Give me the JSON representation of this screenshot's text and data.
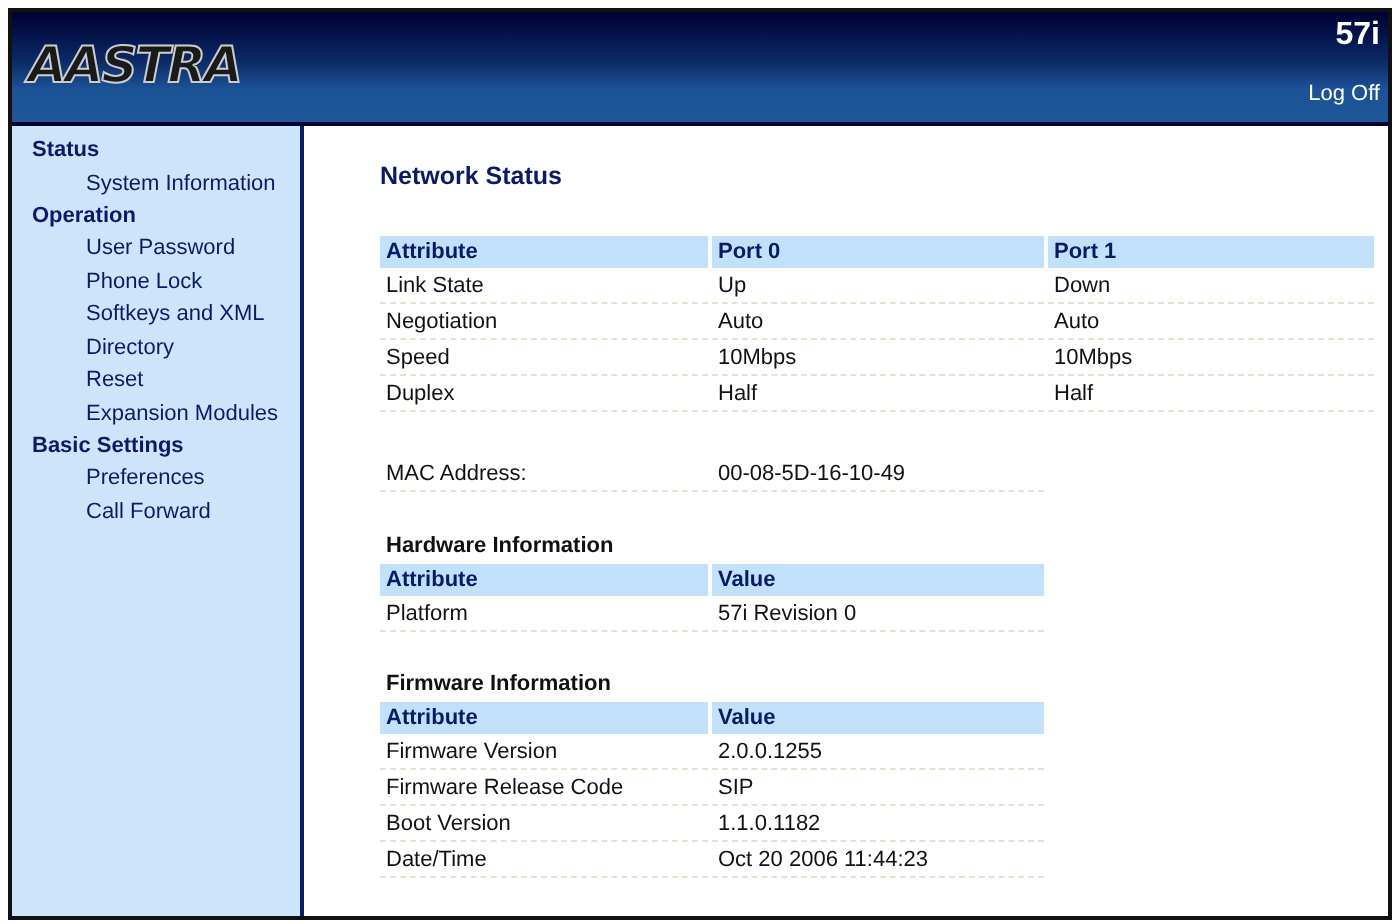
{
  "header": {
    "logo": "AASTRA",
    "model": "57i",
    "logoff": "Log Off"
  },
  "sidebar": [
    {
      "label": "Status",
      "items": [
        {
          "label": "System Information"
        }
      ]
    },
    {
      "label": "Operation",
      "items": [
        {
          "label": "User Password"
        },
        {
          "label": "Phone Lock"
        },
        {
          "label": "Softkeys and XML"
        },
        {
          "label": "Directory"
        },
        {
          "label": "Reset"
        },
        {
          "label": "Expansion Modules"
        }
      ]
    },
    {
      "label": "Basic Settings",
      "items": [
        {
          "label": "Preferences"
        },
        {
          "label": "Call Forward"
        }
      ]
    }
  ],
  "title": "Network Status",
  "network_table": {
    "columns": [
      "Attribute",
      "Port 0",
      "Port 1"
    ],
    "rows": [
      [
        "Link State",
        "Up",
        "Down"
      ],
      [
        "Negotiation",
        "Auto",
        "Auto"
      ],
      [
        "Speed",
        "10Mbps",
        "10Mbps"
      ],
      [
        "Duplex",
        "Half",
        "Half"
      ]
    ]
  },
  "mac": {
    "label": "MAC Address:",
    "value": "00-08-5D-16-10-49"
  },
  "sections": [
    {
      "title": "Hardware Information",
      "columns": [
        "Attribute",
        "Value"
      ],
      "rows": [
        [
          "Platform",
          "57i Revision 0"
        ]
      ]
    },
    {
      "title": "Firmware Information",
      "columns": [
        "Attribute",
        "Value"
      ],
      "rows": [
        [
          "Firmware Version",
          "2.0.0.1255"
        ],
        [
          "Firmware Release Code",
          "SIP"
        ],
        [
          "Boot Version",
          "1.1.0.1182"
        ],
        [
          "Date/Time",
          "Oct 20 2006 11:44:23"
        ]
      ]
    }
  ]
}
